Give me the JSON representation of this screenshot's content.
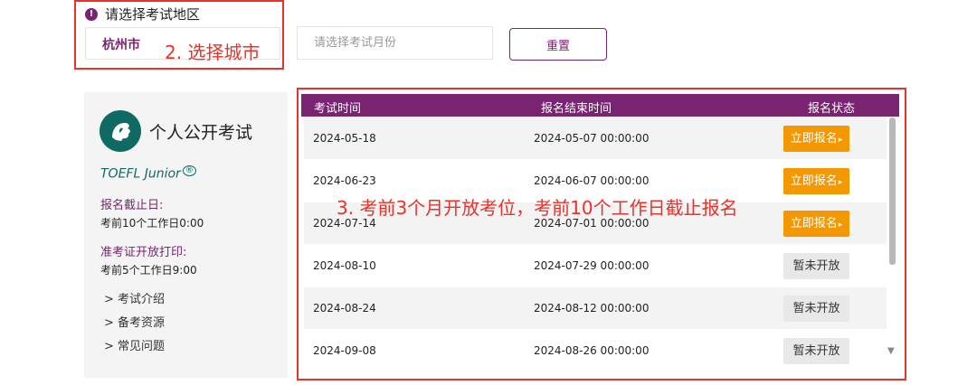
{
  "filters": {
    "warning_text": "请选择考试地区",
    "city_value": "杭州市",
    "month_placeholder": "请选择考试月份",
    "reset_label": "重置"
  },
  "annotations": {
    "step2": "2. 选择城市",
    "step3": "3. 考前3个月开放考位，考前10个工作日截止报名"
  },
  "info_panel": {
    "title": "个人公开考试",
    "product": "TOEFL Junior",
    "product_mark": "®",
    "deadline_label": "报名截止日:",
    "deadline_value": "考前10个工作日0:00",
    "ticket_label": "准考证开放打印:",
    "ticket_value": "考前5个工作日9:00",
    "links": [
      "> 考试介绍",
      "> 备考资源",
      "> 常见问题"
    ]
  },
  "table": {
    "headers": [
      "考试时间",
      "报名结束时间",
      "报名状态"
    ],
    "rows": [
      {
        "date": "2024-05-18",
        "end": "2024-05-07 00:00:00",
        "status": "立即报名",
        "open": true
      },
      {
        "date": "2024-06-23",
        "end": "2024-06-07 00:00:00",
        "status": "立即报名",
        "open": true
      },
      {
        "date": "2024-07-14",
        "end": "2024-07-01 00:00:00",
        "status": "立即报名",
        "open": true
      },
      {
        "date": "2024-08-10",
        "end": "2024-07-29 00:00:00",
        "status": "暂未开放",
        "open": false
      },
      {
        "date": "2024-08-24",
        "end": "2024-08-12 00:00:00",
        "status": "暂未开放",
        "open": false
      },
      {
        "date": "2024-09-08",
        "end": "2024-08-26 00:00:00",
        "status": "暂未开放",
        "open": false
      }
    ]
  },
  "colors": {
    "brand_purple": "#7a2370",
    "teal": "#0e6a63",
    "orange": "#f39800",
    "annotation_red": "#e8322a"
  }
}
